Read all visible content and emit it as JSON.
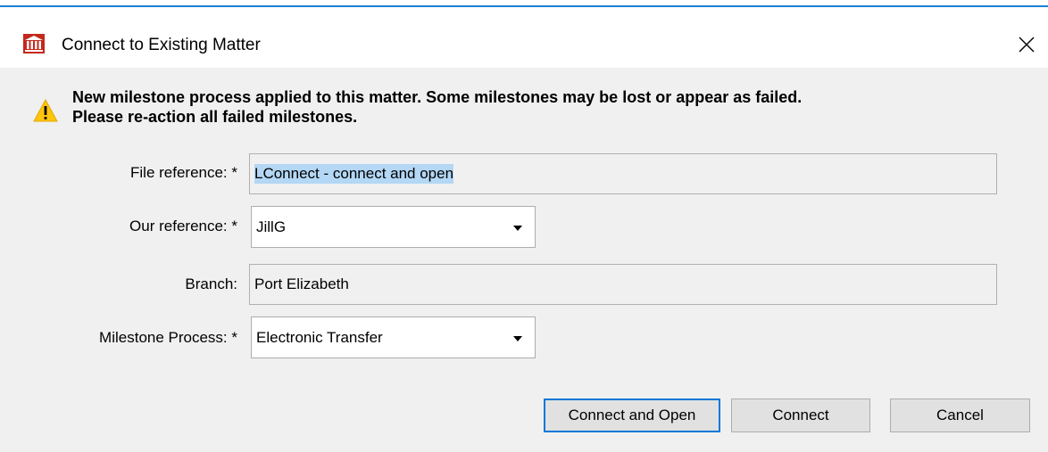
{
  "window": {
    "title": "Connect to Existing Matter",
    "app_icon": "building-columns-icon",
    "close_glyph": "✕"
  },
  "warning": {
    "icon": "warning-triangle-icon",
    "line1": "New milestone process applied to this matter. Some milestones may be lost or appear as failed.",
    "line2": "Please re-action all failed milestones."
  },
  "form": {
    "file_reference": {
      "label": "File reference: *",
      "value": "LConnect - connect and open"
    },
    "our_reference": {
      "label": "Our reference: *",
      "value": "JillG"
    },
    "branch": {
      "label": "Branch:",
      "value": "Port Elizabeth"
    },
    "milestone_process": {
      "label": "Milestone Process: *",
      "value": "Electronic Transfer"
    }
  },
  "buttons": {
    "connect_and_open": "Connect and Open",
    "connect": "Connect",
    "cancel": "Cancel"
  },
  "colors": {
    "accent": "#0078d7",
    "selection": "#b3d7f5",
    "warning": "#ffc40d",
    "app_icon": "#c4281c"
  }
}
